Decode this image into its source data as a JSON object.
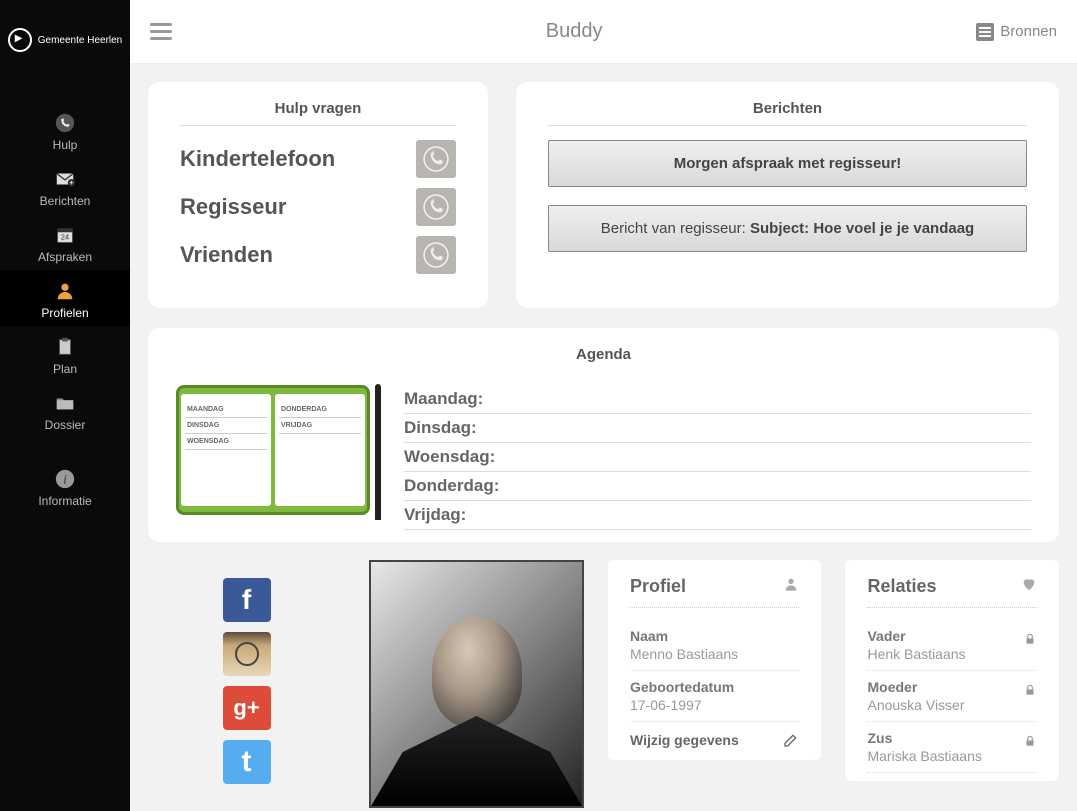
{
  "header": {
    "title": "Buddy",
    "bronnen": "Bronnen"
  },
  "sidebar": {
    "logo": "Gemeente Heerlen",
    "items": [
      {
        "label": "Hulp"
      },
      {
        "label": "Berichten"
      },
      {
        "label": "Afspraken"
      },
      {
        "label": "Profielen"
      },
      {
        "label": "Plan"
      },
      {
        "label": "Dossier"
      },
      {
        "label": "Informatie"
      }
    ]
  },
  "hulp": {
    "title": "Hulp vragen",
    "items": [
      {
        "label": "Kindertelefoon"
      },
      {
        "label": "Regisseur"
      },
      {
        "label": "Vrienden"
      }
    ]
  },
  "berichten": {
    "title": "Berichten",
    "msg1": "Morgen afspraak met regisseur!",
    "msg2_prefix": "Bericht van regisseur: ",
    "msg2_subject": "Subject: Hoe voel je je vandaag"
  },
  "agenda": {
    "title": "Agenda",
    "book_left": [
      "MAANDAG",
      "DINSDAG",
      "WOENSDAG"
    ],
    "book_right": [
      "DONDERDAG",
      "VRIJDAG"
    ],
    "days": [
      "Maandag:",
      "Dinsdag:",
      "Woensdag:",
      "Donderdag:",
      "Vrijdag:"
    ]
  },
  "social": {
    "fb": "f",
    "ig": "",
    "gp": "g+",
    "tw": "t"
  },
  "profiel": {
    "title": "Profiel",
    "naam_label": "Naam",
    "naam_value": "Menno Bastiaans",
    "geb_label": "Geboortedatum",
    "geb_value": "17-06-1997",
    "wijzig": "Wijzig gegevens"
  },
  "relaties": {
    "title": "Relaties",
    "rows": [
      {
        "label": "Vader",
        "value": "Henk Bastiaans"
      },
      {
        "label": "Moeder",
        "value": "Anouska Visser"
      },
      {
        "label": "Zus",
        "value": "Mariska Bastiaans"
      }
    ]
  }
}
